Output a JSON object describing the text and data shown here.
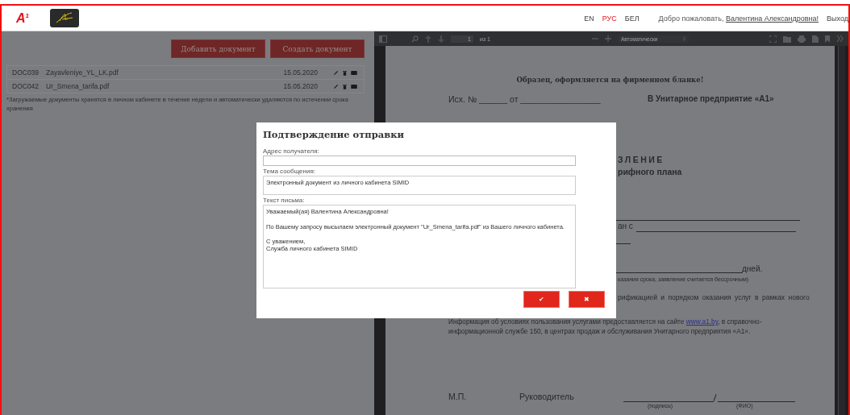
{
  "header": {
    "logo": "A$^{1}$",
    "languages": [
      {
        "label": "EN",
        "selected": false
      },
      {
        "label": "РУС",
        "selected": true
      },
      {
        "label": "БЕЛ",
        "selected": false
      }
    ],
    "greeting": "Добро пожаловать, ",
    "user_name": "Валентина Александровна!",
    "logout": "Выход"
  },
  "actions": [
    "Добавить документ",
    "Создать документ"
  ],
  "documents": [
    {
      "id": "DOC039",
      "file": "Zayavleniye_YL_LK.pdf",
      "date": "15.05.2020"
    },
    {
      "id": "DOC042",
      "file": "Ur_Smena_tarifa.pdf",
      "date": "15.05.2020"
    }
  ],
  "note": "*Загружаемые документы хранятся в личном кабинете в течение недели и автоматически удаляются по истечении срока хранения",
  "viewer": {
    "page_number": "1",
    "page_count": "из 1",
    "zoom": "Автоматически",
    "page": {
      "sample_note": "Образец, оформляется на фирменном бланке!",
      "outgoing": "Исх. № ______ от _________________",
      "addressee": "В Унитарное предприятие «А1»",
      "title_fragment": "ЗЛЕНИЕ",
      "subtitle_fragment": "рифного плана",
      "plan_fragment": "ан с",
      "period_suffix": "дней.",
      "footnote_fragment": "казания срока, заявление считается бессрочным)",
      "terms_fragment": "рификацией и порядком оказания услуг в рамках нового",
      "info_before": "Информация об условиях пользования услугами предоставляется на сайте ",
      "info_link": "www.a1.by",
      "info_after": ", в справочно-информационной службе 150, в центрах продаж и обслуживания Унитарного предприятия «А1».",
      "stamp": "М.П.",
      "signer": "Руководитель",
      "signature_caption": "(подпись)",
      "name_caption": "(ФИО)"
    }
  },
  "dialog": {
    "title": "Подтверждение отправки",
    "fields": [
      {
        "label": "Адрес получателя:",
        "kind": "input"
      },
      {
        "label": "Тема сообщения:",
        "kind": "textarea",
        "value": "Электронный документ из личного кабинета SIMID"
      },
      {
        "label": "Текст письма:",
        "kind": "message",
        "value": "Уважаемый(ая) Валентина Александровна!\n\nПо Вашему запросу высылаем электронный документ \"Ur_Smena_tarifa.pdf\" из Вашего личного кабинета.\n\nС уважением,\nСлужба личного кабинета SIMID"
      }
    ],
    "confirm": "✔",
    "cancel": "✖"
  }
}
